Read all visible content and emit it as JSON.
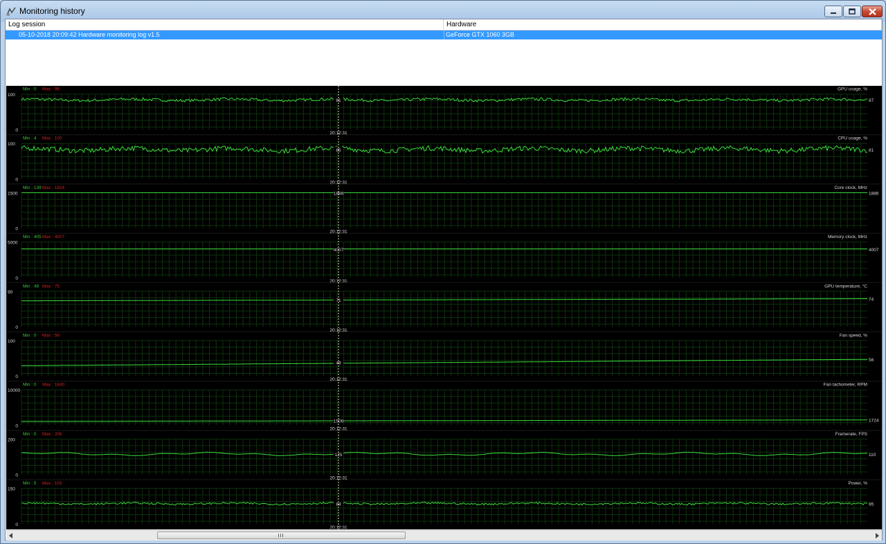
{
  "window": {
    "title": "Monitoring history",
    "icons": {
      "app": "monitor-icon",
      "minimize": "minimize-icon",
      "maximize": "maximize-icon",
      "close": "close-icon"
    }
  },
  "log_list": {
    "columns": [
      "Log session",
      "Hardware"
    ],
    "rows": [
      {
        "session": "05-10-2018 20:09:42 Hardware monitoring log v1.5",
        "hardware": "GeForce GTX 1060 3GB",
        "selected": true
      }
    ]
  },
  "cursor_time": "20:12:31",
  "colors": {
    "trace": "#3cdc3c",
    "min_label": "#3cc83c",
    "max_label": "#d22020",
    "grid": "#0d320d",
    "background": "#000000",
    "selection": "#3399ff"
  },
  "graphs": [
    {
      "name": "GPU usage, %",
      "ymax": "100",
      "ymin": "0",
      "min": "Min : 0",
      "max": "Max : 99",
      "cursor_value": "81",
      "current": "87",
      "type": "noisy",
      "level": 0.84,
      "amp": 0.05,
      "drift": 0
    },
    {
      "name": "CPU usage, %",
      "ymax": "100",
      "ymin": "0",
      "min": "Min : 4",
      "max": "Max : 100",
      "cursor_value": "85",
      "current": "81",
      "type": "noisy",
      "level": 0.83,
      "amp": 0.09,
      "drift": 0
    },
    {
      "name": "Core clock, MHz",
      "ymax": "1500",
      "ymin": "0",
      "min": "Min : 139",
      "max": "Max : 1924",
      "cursor_value": "1886",
      "current": "1886",
      "type": "flat",
      "level": 1.0,
      "amp": 0,
      "drift": 0
    },
    {
      "name": "Memory clock, MHz",
      "ymax": "5000",
      "ymin": "0",
      "min": "Min : 405",
      "max": "Max : 4007",
      "cursor_value": "4007",
      "current": "4007",
      "type": "flat",
      "level": 0.8,
      "amp": 0,
      "drift": 0
    },
    {
      "name": "GPU temperature, °C",
      "ymax": "90",
      "ymin": "0",
      "min": "Min : 49",
      "max": "Max : 75",
      "cursor_value": "71",
      "current": "74",
      "type": "ramp",
      "level": 0.76,
      "amp": 0.003,
      "drift": 0.06
    },
    {
      "name": "Fan speed, %",
      "ymax": "100",
      "ymin": "0",
      "min": "Min : 0",
      "max": "Max : 59",
      "cursor_value": "49",
      "current": "56",
      "type": "ramp",
      "level": 0.38,
      "amp": 0.002,
      "drift": 0.18
    },
    {
      "name": "Fan tachometer, RPM",
      "ymax": "10000",
      "ymin": "0",
      "min": "Min : 0",
      "max": "Max : 1840",
      "cursor_value": "1506",
      "current": "1724",
      "type": "ramp",
      "level": 0.13,
      "amp": 0.001,
      "drift": 0.04
    },
    {
      "name": "Framerate, FPS",
      "ymax": "200",
      "ymin": "0",
      "min": "Min : 0",
      "max": "Max : 208",
      "cursor_value": "125",
      "current": "110",
      "type": "wavy",
      "level": 0.58,
      "amp": 0.03,
      "drift": 0
    },
    {
      "name": "Power, %",
      "ymax": "150",
      "ymin": "0",
      "min": "Min : 5",
      "max": "Max : 103",
      "cursor_value": "84",
      "current": "95",
      "type": "noisy",
      "level": 0.57,
      "amp": 0.035,
      "drift": 0
    }
  ],
  "scrollbar": {
    "thumb_start": 0.165,
    "thumb_length": 0.29
  }
}
